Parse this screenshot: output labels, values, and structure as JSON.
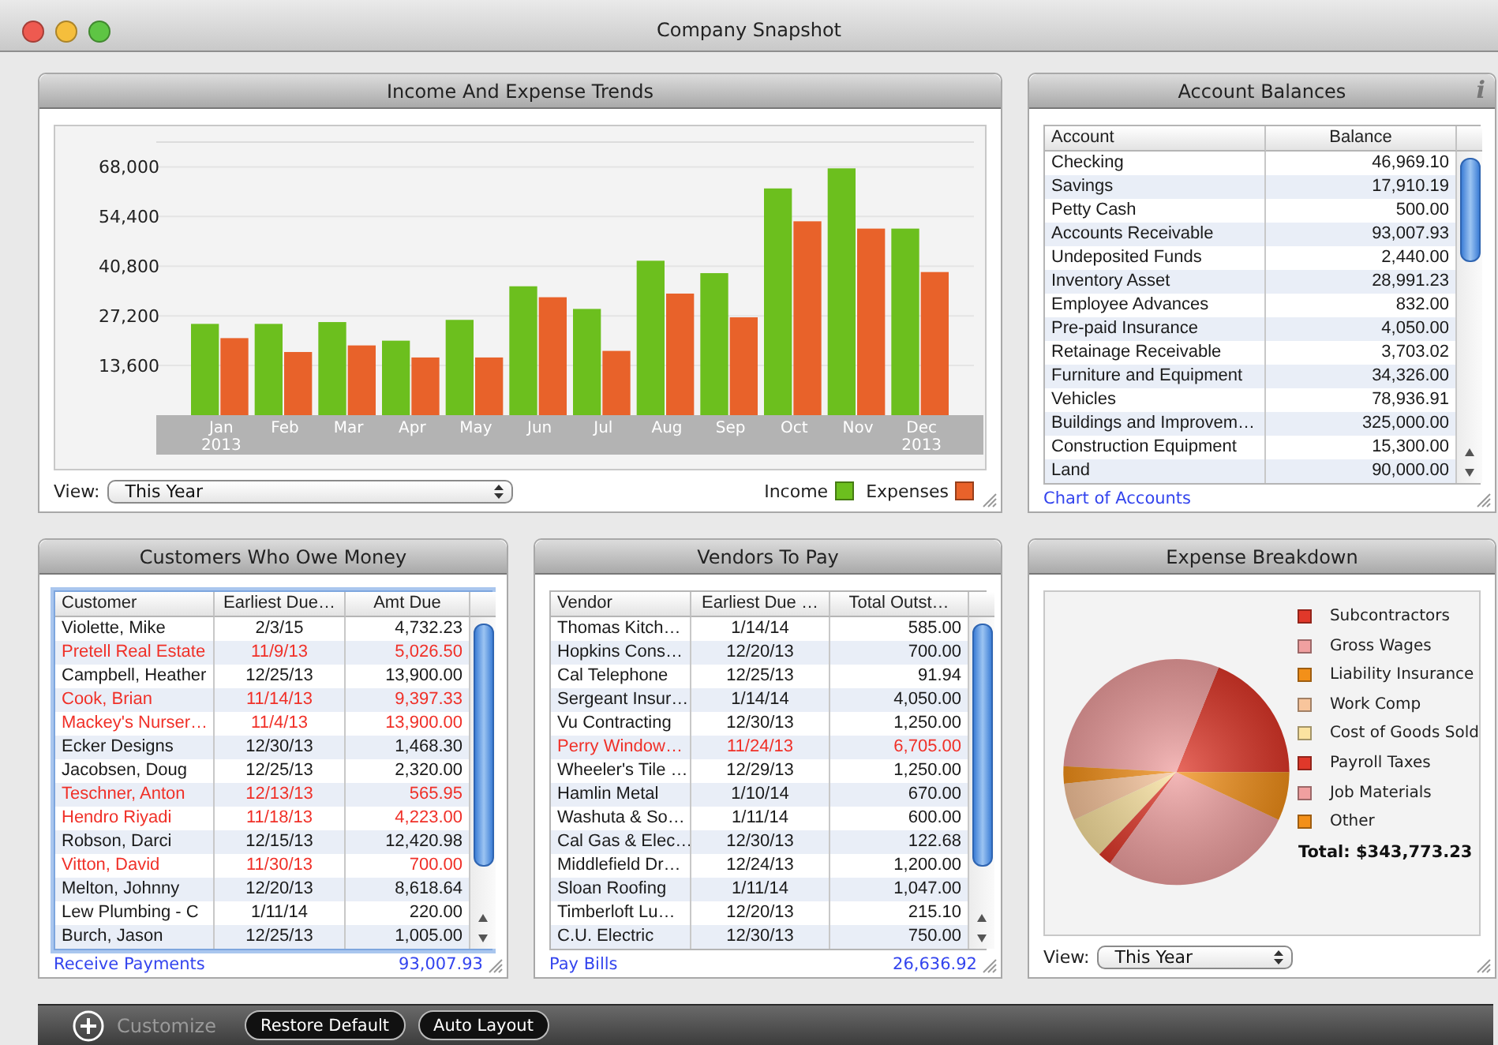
{
  "window": {
    "title": "Company Snapshot"
  },
  "trends": {
    "title": "Income And Expense Trends",
    "chart_data": {
      "type": "bar",
      "categories": [
        "Jan",
        "Feb",
        "Mar",
        "Apr",
        "May",
        "Jun",
        "Jul",
        "Aug",
        "Sep",
        "Oct",
        "Nov",
        "Dec"
      ],
      "series": [
        {
          "name": "Income",
          "color": "#6cbf1e",
          "values": [
            25000,
            25000,
            25500,
            20400,
            26100,
            35300,
            29100,
            42300,
            38900,
            62100,
            67600,
            51100
          ]
        },
        {
          "name": "Expenses",
          "color": "#e8622a",
          "values": [
            21100,
            17300,
            19100,
            15800,
            15800,
            32300,
            17600,
            33300,
            26800,
            53100,
            51100,
            39200
          ]
        }
      ],
      "ylim": [
        0,
        74800
      ],
      "grid": true,
      "yticks": [
        {
          "value": 13600,
          "label": "13,600"
        },
        {
          "value": 27200,
          "label": "27,200"
        },
        {
          "value": 40800,
          "label": "40,800"
        },
        {
          "value": 54400,
          "label": "54,400"
        },
        {
          "value": 68000,
          "label": "68,000"
        }
      ],
      "annotations": [
        "2013",
        "2013"
      ]
    },
    "view": {
      "label": "View:",
      "value": "This Year"
    }
  },
  "balances": {
    "title": "Account Balances",
    "info": "i",
    "columns": [
      "Account",
      "Balance"
    ],
    "rows": [
      {
        "account": "Checking",
        "balance": "46,969.10"
      },
      {
        "account": "Savings",
        "balance": "17,910.19"
      },
      {
        "account": "Petty Cash",
        "balance": "500.00"
      },
      {
        "account": "Accounts Receivable",
        "balance": "93,007.93"
      },
      {
        "account": "Undeposited Funds",
        "balance": "2,440.00"
      },
      {
        "account": "Inventory Asset",
        "balance": "28,991.23"
      },
      {
        "account": "Employee Advances",
        "balance": "832.00"
      },
      {
        "account": "Pre-paid Insurance",
        "balance": "4,050.00"
      },
      {
        "account": "Retainage Receivable",
        "balance": "3,703.02"
      },
      {
        "account": "Furniture and Equipment",
        "balance": "34,326.00"
      },
      {
        "account": "Vehicles",
        "balance": "78,936.91"
      },
      {
        "account": "Buildings and Improvem…",
        "balance": "325,000.00"
      },
      {
        "account": "Construction Equipment",
        "balance": "15,300.00"
      },
      {
        "account": "Land",
        "balance": "90,000.00"
      }
    ],
    "link": "Chart of Accounts"
  },
  "customers": {
    "title": "Customers Who Owe Money",
    "columns": [
      "Customer",
      "Earliest Due…",
      "Amt Due"
    ],
    "rows": [
      {
        "name": "Violette, Mike",
        "due": "2/3/15",
        "amount": "4,732.23",
        "overdue": false
      },
      {
        "name": "Pretell Real Estate",
        "due": "11/9/13",
        "amount": "5,026.50",
        "overdue": true
      },
      {
        "name": "Campbell, Heather",
        "due": "12/25/13",
        "amount": "13,900.00",
        "overdue": false
      },
      {
        "name": "Cook, Brian",
        "due": "11/14/13",
        "amount": "9,397.33",
        "overdue": true
      },
      {
        "name": "Mackey's Nurser…",
        "due": "11/4/13",
        "amount": "13,900.00",
        "overdue": true
      },
      {
        "name": "Ecker Designs",
        "due": "12/30/13",
        "amount": "1,468.30",
        "overdue": false
      },
      {
        "name": "Jacobsen, Doug",
        "due": "12/25/13",
        "amount": "2,320.00",
        "overdue": false
      },
      {
        "name": "Teschner, Anton",
        "due": "12/13/13",
        "amount": "565.95",
        "overdue": true
      },
      {
        "name": "Hendro Riyadi",
        "due": "11/18/13",
        "amount": "4,223.00",
        "overdue": true
      },
      {
        "name": "Robson, Darci",
        "due": "12/15/13",
        "amount": "12,420.98",
        "overdue": false
      },
      {
        "name": "Vitton, David",
        "due": "11/30/13",
        "amount": "700.00",
        "overdue": true
      },
      {
        "name": "Melton, Johnny",
        "due": "12/20/13",
        "amount": "8,618.64",
        "overdue": false
      },
      {
        "name": "Lew Plumbing - C",
        "due": "1/11/14",
        "amount": "220.00",
        "overdue": false
      },
      {
        "name": "Burch, Jason",
        "due": "12/25/13",
        "amount": "1,005.00",
        "overdue": false
      }
    ],
    "link": "Receive Payments",
    "total": "93,007.93"
  },
  "vendors": {
    "title": "Vendors To Pay",
    "columns": [
      "Vendor",
      "Earliest Due …",
      "Total Outst…"
    ],
    "rows": [
      {
        "name": "Thomas Kitch…",
        "due": "1/14/14",
        "amount": "585.00",
        "overdue": false
      },
      {
        "name": "Hopkins Cons…",
        "due": "12/20/13",
        "amount": "700.00",
        "overdue": false
      },
      {
        "name": "Cal Telephone",
        "due": "12/25/13",
        "amount": "91.94",
        "overdue": false
      },
      {
        "name": "Sergeant Insur…",
        "due": "1/14/14",
        "amount": "4,050.00",
        "overdue": false
      },
      {
        "name": "Vu Contracting",
        "due": "12/30/13",
        "amount": "1,250.00",
        "overdue": false
      },
      {
        "name": "Perry Window…",
        "due": "11/24/13",
        "amount": "6,705.00",
        "overdue": true
      },
      {
        "name": "Wheeler's Tile …",
        "due": "12/29/13",
        "amount": "1,250.00",
        "overdue": false
      },
      {
        "name": "Hamlin Metal",
        "due": "1/10/14",
        "amount": "670.00",
        "overdue": false
      },
      {
        "name": "Washuta & So…",
        "due": "1/11/14",
        "amount": "600.00",
        "overdue": false
      },
      {
        "name": "Cal Gas & Elec…",
        "due": "12/30/13",
        "amount": "122.68",
        "overdue": false
      },
      {
        "name": "Middlefield Dr…",
        "due": "12/24/13",
        "amount": "1,200.00",
        "overdue": false
      },
      {
        "name": "Sloan Roofing",
        "due": "1/11/14",
        "amount": "1,047.00",
        "overdue": false
      },
      {
        "name": "Timberloft Lu…",
        "due": "12/20/13",
        "amount": "215.10",
        "overdue": false
      },
      {
        "name": "C.U. Electric",
        "due": "12/30/13",
        "amount": "750.00",
        "overdue": false
      }
    ],
    "link": "Pay Bills",
    "total": "26,636.92"
  },
  "expenses": {
    "title": "Expense Breakdown",
    "legend": [
      {
        "label": "Subcontractors",
        "color": "#e0382a"
      },
      {
        "label": "Gross Wages",
        "color": "#f0a0a0"
      },
      {
        "label": "Liability Insurance",
        "color": "#f39019"
      },
      {
        "label": "Work Comp",
        "color": "#f8c59c"
      },
      {
        "label": "Cost of Goods Sold",
        "color": "#fbe3a0"
      },
      {
        "label": "Payroll Taxes",
        "color": "#e0382a"
      },
      {
        "label": "Job Materials",
        "color": "#f0a0a0"
      },
      {
        "label": "Other",
        "color": "#f39019"
      }
    ],
    "total": "Total: $343,773.23",
    "view": {
      "label": "View:",
      "value": "This Year"
    }
  },
  "toolbar": {
    "customize": "Customize",
    "buttons": [
      "Restore Default",
      "Auto Layout"
    ]
  }
}
